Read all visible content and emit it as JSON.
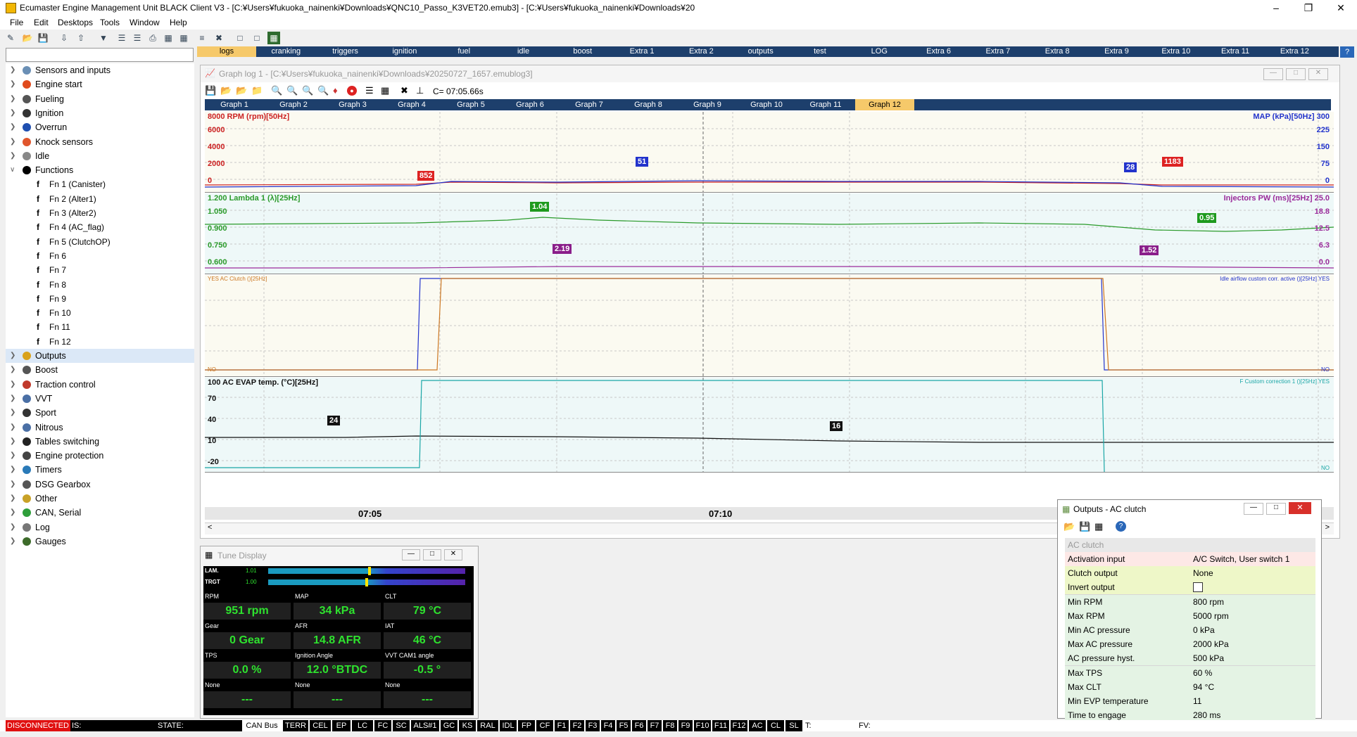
{
  "window": {
    "title": "Ecumaster Engine Management Unit BLACK Client V3 - [C:¥Users¥fukuoka_nainenki¥Downloads¥QNC10_Passo_K3VET20.emub3]   - [C:¥Users¥fukuoka_nainenki¥Downloads¥20"
  },
  "menu": [
    "File",
    "Edit",
    "Desktops",
    "Tools",
    "Window",
    "Help"
  ],
  "tree": [
    {
      "label": "Sensors and inputs",
      "color": "#6a8fb5"
    },
    {
      "label": "Engine start",
      "color": "#e04a1c"
    },
    {
      "label": "Fueling",
      "color": "#555"
    },
    {
      "label": "Ignition",
      "color": "#333"
    },
    {
      "label": "Overrun",
      "color": "#1f4fb0"
    },
    {
      "label": "Knock sensors",
      "color": "#e0562c"
    },
    {
      "label": "Idle",
      "color": "#888"
    },
    {
      "label": "Functions",
      "color": "#000"
    },
    {
      "label": "Fn 1 (Canister)",
      "sub": true
    },
    {
      "label": "Fn 2 (Alter1)",
      "sub": true
    },
    {
      "label": "Fn 3 (Alter2)",
      "sub": true
    },
    {
      "label": "Fn 4 (AC_flag)",
      "sub": true
    },
    {
      "label": "Fn 5 (ClutchOP)",
      "sub": true
    },
    {
      "label": "Fn 6",
      "sub": true
    },
    {
      "label": "Fn 7",
      "sub": true
    },
    {
      "label": "Fn 8",
      "sub": true
    },
    {
      "label": "Fn 9",
      "sub": true
    },
    {
      "label": "Fn 10",
      "sub": true
    },
    {
      "label": "Fn 11",
      "sub": true
    },
    {
      "label": "Fn 12",
      "sub": true
    },
    {
      "label": "Outputs",
      "color": "#d9a21b",
      "selected": true
    },
    {
      "label": "Boost",
      "color": "#555"
    },
    {
      "label": "Traction control",
      "color": "#c0392b"
    },
    {
      "label": "VVT",
      "color": "#4a6fa5"
    },
    {
      "label": "Sport",
      "color": "#333"
    },
    {
      "label": "Nitrous",
      "color": "#4a6fa5"
    },
    {
      "label": "Tables switching",
      "color": "#222"
    },
    {
      "label": "Engine protection",
      "color": "#444"
    },
    {
      "label": "Timers",
      "color": "#2a7ab8"
    },
    {
      "label": "DSG Gearbox",
      "color": "#555"
    },
    {
      "label": "Other",
      "color": "#c9a227"
    },
    {
      "label": "CAN, Serial",
      "color": "#2e9e3a"
    },
    {
      "label": "Log",
      "color": "#777"
    },
    {
      "label": "Gauges",
      "color": "#3d6b2a"
    }
  ],
  "top_tabs": [
    "logs",
    "cranking",
    "triggers",
    "ignition",
    "fuel",
    "idle",
    "boost",
    "Extra 1",
    "Extra 2",
    "outputs",
    "test",
    "LOG",
    "Extra 6",
    "Extra 7",
    "Extra 8",
    "Extra 9",
    "Extra 10",
    "Extra 11",
    "Extra 12"
  ],
  "graph_window": {
    "title": "Graph log 1 - [C:¥Users¥fukuoka_nainenki¥Downloads¥20250727_1657.emublog3]",
    "cursor": "C= 07:05.66s",
    "tabs": [
      "Graph 1",
      "Graph 2",
      "Graph 3",
      "Graph 4",
      "Graph 5",
      "Graph 6",
      "Graph 7",
      "Graph 8",
      "Graph 9",
      "Graph 10",
      "Graph 11",
      "Graph 12"
    ],
    "time_labels": [
      "07:05",
      "07:10"
    ],
    "panel1": {
      "left_title": "8000 RPM (rpm)[50Hz]",
      "right_title": "MAP (kPa)[50Hz] 300",
      "left_ticks": [
        "6000",
        "4000",
        "2000",
        "0"
      ],
      "right_ticks": [
        "225",
        "150",
        "75",
        "0"
      ],
      "tags": [
        "852",
        "51",
        "28",
        "1183"
      ]
    },
    "panel2": {
      "left_title": "1.200 Lambda 1 (λ)[25Hz]",
      "right_title": "Injectors PW (ms)[25Hz] 25.0",
      "left_ticks": [
        "1.050",
        "0.900",
        "0.750",
        "0.600"
      ],
      "right_ticks": [
        "18.8",
        "12.5",
        "6.3",
        "0.0"
      ],
      "tags": [
        "1.04",
        "0.95",
        "2.19",
        "1.52"
      ]
    },
    "panel3": {
      "left_title": "YES AC Clutch ()[25Hz]",
      "right_title": "Idle airflow custom corr. active ()[25Hz] YES",
      "left_bottom": "NO",
      "right_bottom": "NO"
    },
    "panel4": {
      "left_title": "100 AC EVAP temp. (°C)[25Hz]",
      "right_title": "F Custom correction 1 ()[25Hz] YES",
      "left_ticks": [
        "70",
        "40",
        "10",
        "-20"
      ],
      "right_bottom": "NO",
      "tags": [
        "24",
        "16"
      ]
    }
  },
  "tune_display": {
    "title": "Tune Display",
    "lam_label": "LAM.",
    "lam_value": "1.01",
    "trgt_label": "TRGT",
    "trgt_value": "1.00",
    "cells": [
      {
        "name": "RPM",
        "value": "951 rpm"
      },
      {
        "name": "MAP",
        "value": "34 kPa"
      },
      {
        "name": "CLT",
        "value": "79 °C"
      },
      {
        "name": "Gear",
        "value": "0 Gear"
      },
      {
        "name": "AFR",
        "value": "14.8 AFR"
      },
      {
        "name": "IAT",
        "value": "46 °C"
      },
      {
        "name": "TPS",
        "value": "0.0 %"
      },
      {
        "name": "Ignition Angle",
        "value": "12.0 °BTDC"
      },
      {
        "name": "VVT CAM1 angle",
        "value": "-0.5 °"
      },
      {
        "name": "None",
        "value": "---"
      },
      {
        "name": "None",
        "value": "---"
      },
      {
        "name": "None",
        "value": "---"
      }
    ]
  },
  "outputs_window": {
    "title": "Outputs - AC clutch",
    "section": "AC clutch",
    "rows": [
      {
        "key": "Activation input",
        "value": "A/C Switch, User switch 1",
        "bg": "#fde8e6"
      },
      {
        "key": "Clutch output",
        "value": "None",
        "bg": "#eef7c8"
      },
      {
        "key": "Invert output",
        "value": "",
        "bg": "#eef7c8",
        "checkbox": true
      },
      {
        "key": "Min RPM",
        "value": "800 rpm",
        "bg": "#e4f3e4"
      },
      {
        "key": "Max RPM",
        "value": "5000 rpm",
        "bg": "#e4f3e4"
      },
      {
        "key": "Min AC pressure",
        "value": "0 kPa",
        "bg": "#e4f3e4"
      },
      {
        "key": "Max AC pressure",
        "value": "2000 kPa",
        "bg": "#e4f3e4"
      },
      {
        "key": "AC pressure hyst.",
        "value": "500 kPa",
        "bg": "#e4f3e4"
      },
      {
        "key": "Max TPS",
        "value": "60 %",
        "bg": "#e4f3e4"
      },
      {
        "key": "Max CLT",
        "value": "94 °C",
        "bg": "#e4f3e4"
      },
      {
        "key": "Min EVP temperature",
        "value": "11",
        "bg": "#e4f3e4"
      },
      {
        "key": "Time to engage",
        "value": "280 ms",
        "bg": "#e4f3e4"
      }
    ]
  },
  "status": {
    "items": [
      "DISCONNECTED",
      "IS:",
      "STATE:",
      "CAN Bus",
      "TERR",
      "CEL",
      "EP",
      "LC",
      "FC",
      "SC",
      "ALS#1",
      "GC",
      "KS",
      "RAL",
      "IDL",
      "FP",
      "CF",
      "F1",
      "F2",
      "F3",
      "F4",
      "F5",
      "F6",
      "F7",
      "F8",
      "F9",
      "F10",
      "F11",
      "F12",
      "AC",
      "CL",
      "SL",
      "T:",
      "FV:"
    ]
  }
}
